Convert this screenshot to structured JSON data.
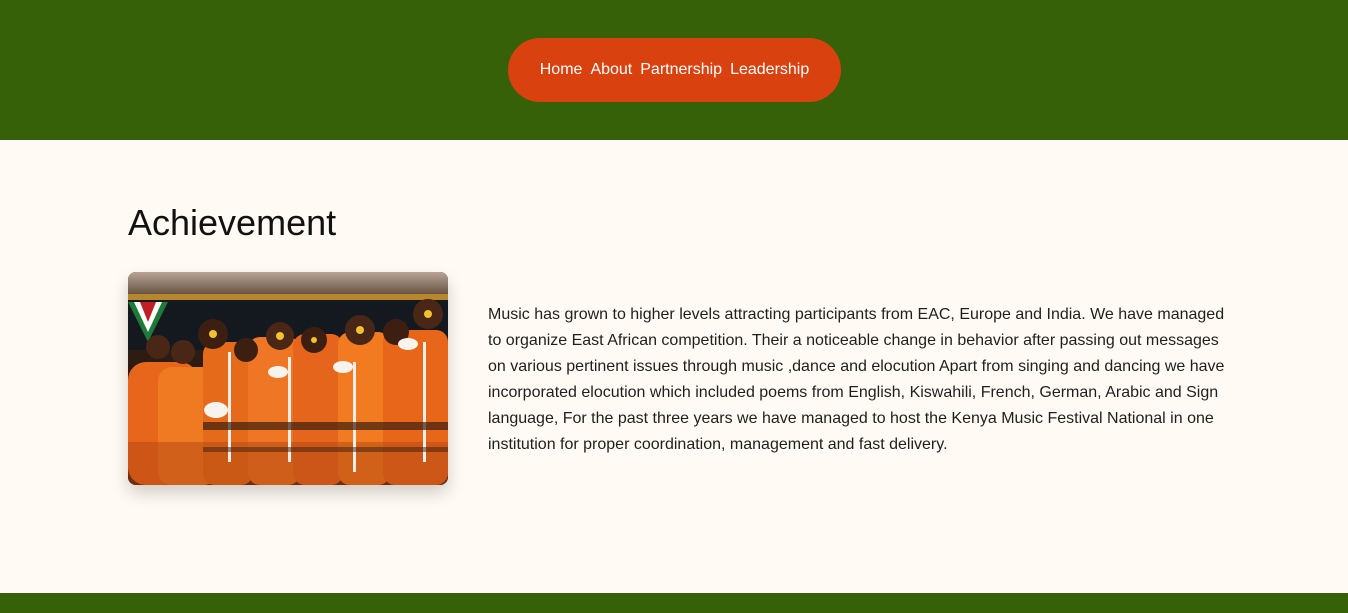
{
  "nav": {
    "items": [
      "Home",
      "About",
      "Partnership",
      "Leadership"
    ]
  },
  "achievement": {
    "title": "Achievement",
    "image_alt": "Performers in orange costumes dancing on stage",
    "text": "Music has grown to higher levels attracting participants from EAC, Europe and India. We have managed to organize East African competition. Their a noticeable change in behavior after passing out messages on various pertinent issues through music ,dance and elocution Apart from singing and dancing we have incorporated elocution which included poems from English, Kiswahili, French, German, Arabic and Sign language, For the past three years we have managed to host the Kenya Music Festival National in one institution for proper coordination, management and fast delivery."
  },
  "colors": {
    "header_bg": "#376109",
    "nav_bg": "#d9420f",
    "page_bg": "#fffaf3"
  }
}
